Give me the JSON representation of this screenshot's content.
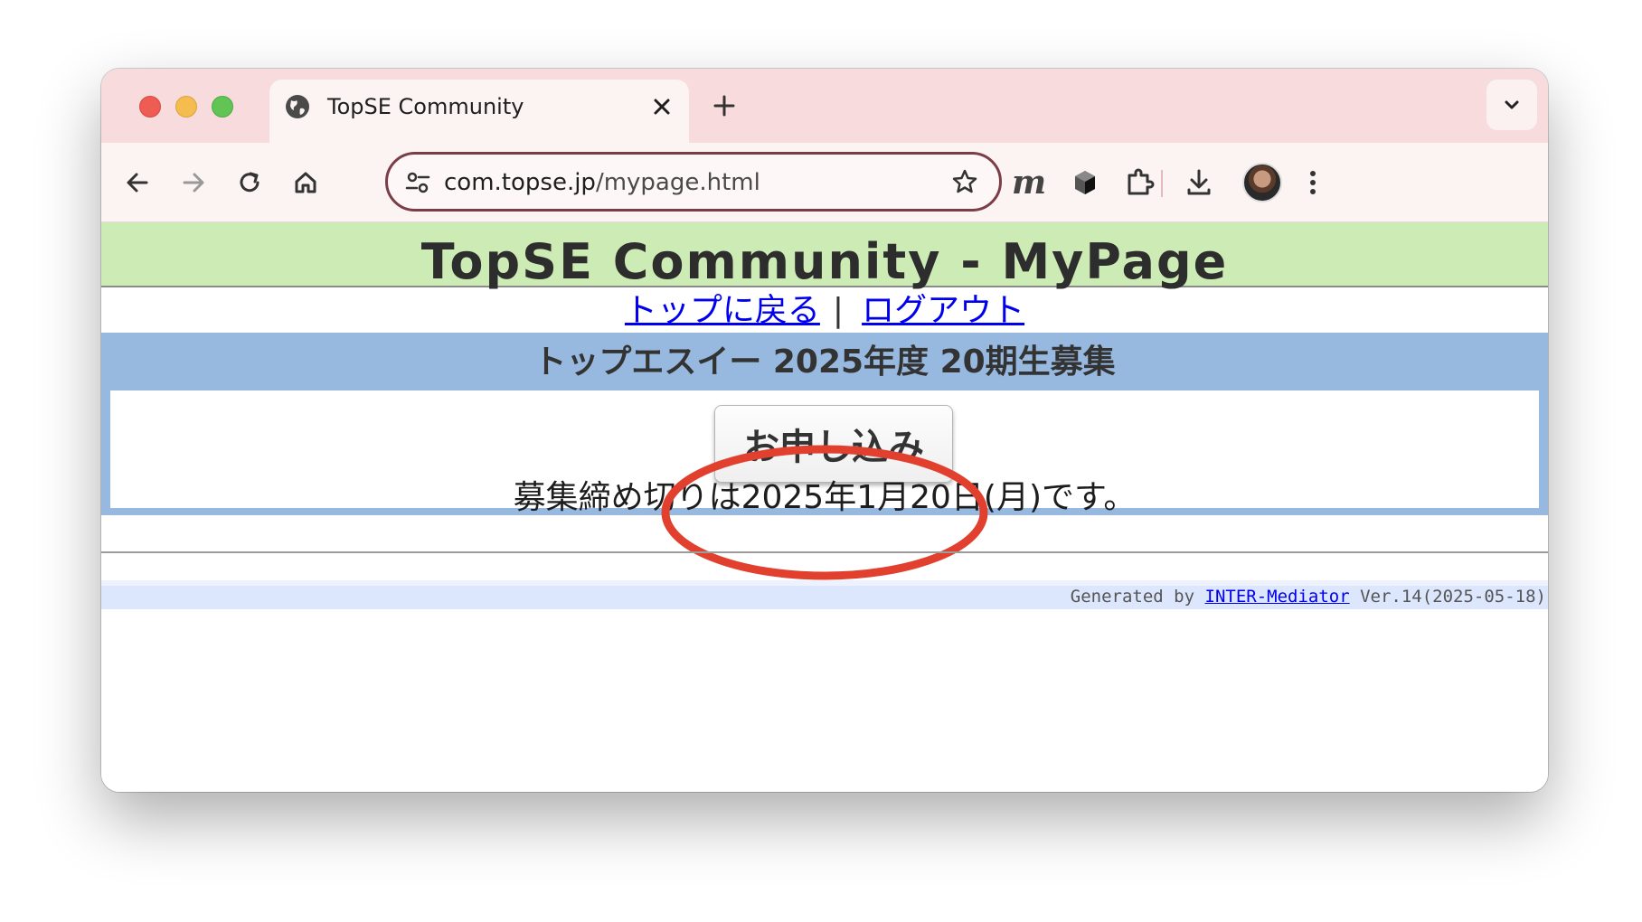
{
  "browser": {
    "tab_title": "TopSE Community",
    "url_host": "com.topse.jp",
    "url_path": "/mypage.html",
    "extension_label": "m"
  },
  "page": {
    "title": "TopSE Community - MyPage",
    "nav": {
      "back_to_top": "トップに戻る",
      "separator": "|",
      "logout": "ログアウト"
    },
    "recruitment": {
      "title": "トップエスイー 2025年度 20期生募集",
      "apply_button": "お申し込み",
      "deadline": "募集締め切りは2025年1月20日(月)です。"
    },
    "footer": {
      "prefix": "Generated by ",
      "link": "INTER-Mediator",
      "version": " Ver.14(2025-05-18)"
    }
  },
  "colors": {
    "tab_bar": "#f8dcdd",
    "header_bg": "#cdebb4",
    "recruit_bg": "#98b9df",
    "highlight_ring": "#e2402e",
    "link": "#0000ee"
  }
}
